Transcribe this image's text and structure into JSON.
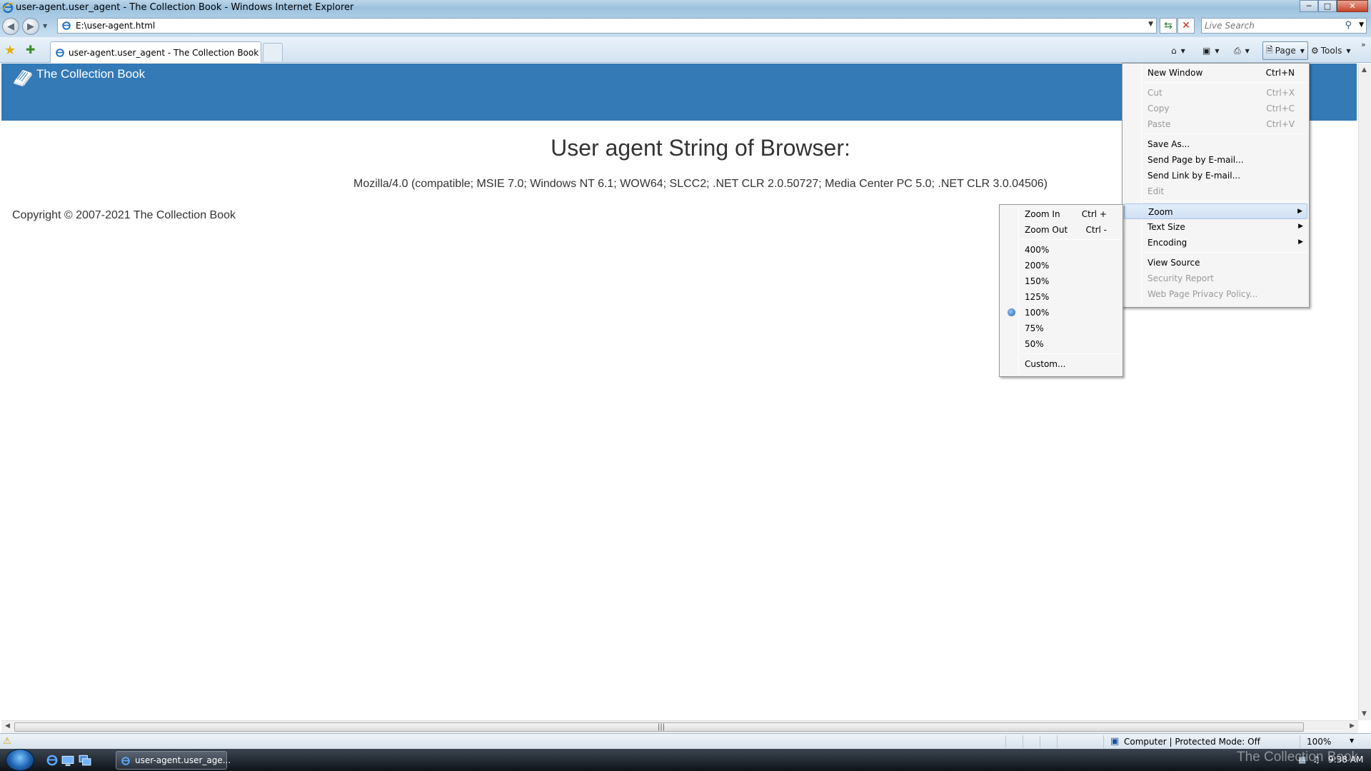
{
  "window": {
    "title": "user-agent.user_agent - The Collection Book - Windows Internet Explorer",
    "minimize_glyph": "─",
    "restore_glyph": "□",
    "close_glyph": "✕"
  },
  "address_bar": {
    "url": "E:\\user-agent.html",
    "search_placeholder": "Live Search"
  },
  "tabs": [
    {
      "label": "user-agent.user_agent - The Collection Book"
    }
  ],
  "command_bar": {
    "page_label": "Page",
    "tools_label": "Tools"
  },
  "site": {
    "brand": "The Collection Book",
    "header_color": "#337ab7",
    "title": "User agent String of Browser:",
    "user_agent": "Mozilla/4.0 (compatible; MSIE 7.0; Windows NT 6.1; WOW64; SLCC2; .NET CLR 2.0.50727; Media Center PC 5.0; .NET CLR 3.0.04506)",
    "copyright": "Copyright © 2007-2021 The Collection Book"
  },
  "page_menu": {
    "items": [
      {
        "label": "New Window",
        "shortcut": "Ctrl+N",
        "disabled": false
      },
      {
        "label": "Cut",
        "shortcut": "Ctrl+X",
        "disabled": true
      },
      {
        "label": "Copy",
        "shortcut": "Ctrl+C",
        "disabled": true
      },
      {
        "label": "Paste",
        "shortcut": "Ctrl+V",
        "disabled": true
      },
      {
        "label": "Save As...",
        "disabled": false
      },
      {
        "label": "Send Page by E-mail...",
        "disabled": false
      },
      {
        "label": "Send Link by E-mail...",
        "disabled": false
      },
      {
        "label": "Edit",
        "disabled": true
      },
      {
        "label": "Zoom",
        "submenu": true,
        "highlighted": true
      },
      {
        "label": "Text Size",
        "submenu": true
      },
      {
        "label": "Encoding",
        "submenu": true
      },
      {
        "label": "View Source",
        "disabled": false
      },
      {
        "label": "Security Report",
        "disabled": true
      },
      {
        "label": "Web Page Privacy Policy...",
        "disabled": true
      }
    ]
  },
  "zoom_menu": {
    "items": [
      {
        "label": "Zoom In",
        "shortcut": "Ctrl +"
      },
      {
        "label": "Zoom Out",
        "shortcut": "Ctrl -"
      },
      {
        "label": "400%"
      },
      {
        "label": "200%"
      },
      {
        "label": "150%"
      },
      {
        "label": "125%"
      },
      {
        "label": "100%",
        "selected": true
      },
      {
        "label": "75%"
      },
      {
        "label": "50%"
      },
      {
        "label": "Custom..."
      }
    ]
  },
  "status_bar": {
    "zone": "Computer | Protected Mode: Off",
    "zoom": "100%"
  },
  "taskbar": {
    "task_label": "user-agent.user_age...",
    "clock": "9:38 AM",
    "watermark": "The Collection Book"
  },
  "icons": {
    "app": "ie-icon",
    "favorites": "star-icon",
    "add_favorites": "add-favorite-icon",
    "home": "home-icon",
    "feeds": "feeds-icon",
    "print": "printer-icon",
    "page": "page-icon",
    "tools": "gear-icon",
    "search": "search-icon",
    "refresh": "refresh-icon",
    "stop": "stop-icon",
    "zone": "computer-icon",
    "start": "windows-orb-icon"
  }
}
